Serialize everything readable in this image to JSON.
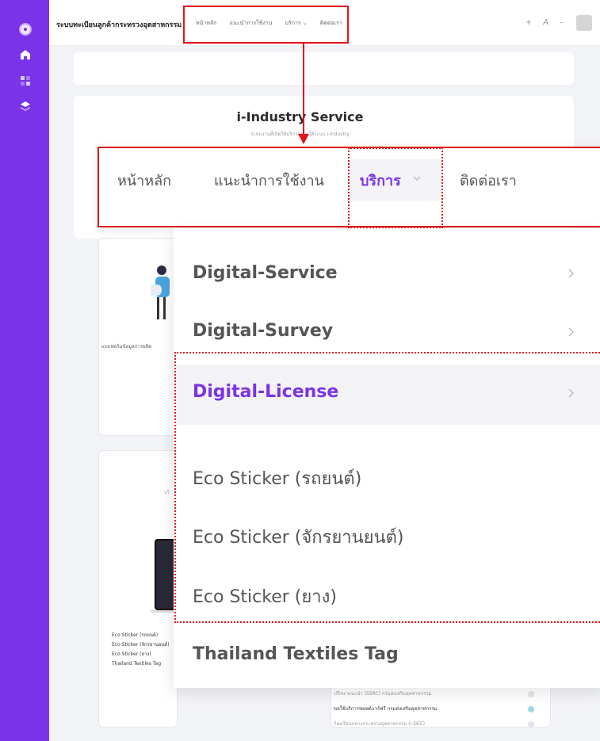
{
  "header": {
    "brand": "ระบบทะเบียนลูกค้ากระทรวงอุตสาหกรรม",
    "nav": [
      "หน้าหลัก",
      "แนะนำการใช้งาน",
      "บริการ ⌄",
      "ติดต่อเรา"
    ],
    "tools": [
      "+",
      "A",
      "–"
    ]
  },
  "main": {
    "title": "i-Industry Service",
    "subtitle": "ระบบงานที่เปิดให้บริการภายใต้ระบบ i-Industry",
    "form_label": "แบบฟอร์มข้อมูลการผลิต",
    "small_caption": "บริ",
    "eco_list": [
      "Eco Sticker (รถยนต์)",
      "Eco Sticker (จักรยานยนต์)",
      "Eco Sticker (ยาง)",
      "Thailand Textiles Tag"
    ],
    "rows": [
      {
        "label": "ปรึกษาแนะนำ (SSRC) กรมส่งเสริมอุตสาหกรรม",
        "status": "x"
      },
      {
        "label": "ขอใช้บริการซอฟต์แวร์ฟรี กรมส่งเสริมอุตสาหกรรม",
        "status": "ok"
      },
      {
        "label": "ร้องเรียนกลางกระทรวงอุตสาหกรรม (i-DEE)",
        "status": "x"
      }
    ]
  },
  "zoom_nav": {
    "home": "หน้าหลัก",
    "guide": "แนะนำการใช้งาน",
    "service": "บริการ",
    "contact": "ติดต่อเรา"
  },
  "dropdown": {
    "items": [
      "Digital-Service",
      "Digital-Survey",
      "Digital-License",
      "Eco Sticker (รถยนต์)",
      "Eco Sticker (จักรยานยนต์)",
      "Eco Sticker (ยาง)",
      "Thailand Textiles Tag"
    ],
    "active": "Digital-License"
  },
  "colors": {
    "accent": "#7a33e6",
    "annotation": "#e0151b"
  },
  "icons": [
    "logo-icon",
    "home-icon",
    "grid-icon",
    "layers-icon",
    "chevron-down-icon",
    "chevron-right-icon"
  ]
}
